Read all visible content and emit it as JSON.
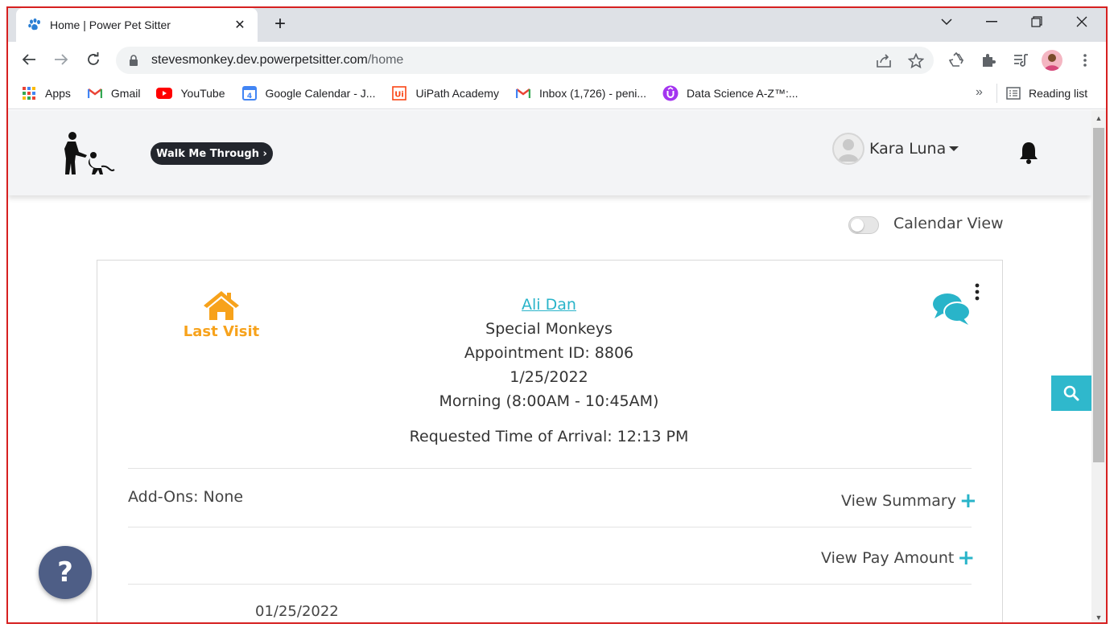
{
  "browser": {
    "tab_title": "Home | Power Pet Sitter",
    "tab_close": "✕",
    "new_tab": "+",
    "url_host": "stevesmonkey.dev.powerpetsitter.com",
    "url_path": "/home",
    "bookmarks": [
      {
        "label": "Apps",
        "icon": "apps-grid-icon"
      },
      {
        "label": "Gmail",
        "icon": "gmail-icon"
      },
      {
        "label": "YouTube",
        "icon": "youtube-icon"
      },
      {
        "label": "Google Calendar - J...",
        "icon": "google-calendar-icon"
      },
      {
        "label": "UiPath Academy",
        "icon": "uipath-icon"
      },
      {
        "label": "Inbox (1,726) - peni...",
        "icon": "gmail-icon"
      },
      {
        "label": "Data Science A-Z™:...",
        "icon": "udemy-icon"
      }
    ],
    "bookmarks_more": "»",
    "reading_list": "Reading list"
  },
  "header": {
    "walk_button": "Walk Me Through ›",
    "user_name": "Kara Luna"
  },
  "view_toggle": {
    "label": "Calendar View",
    "on": false
  },
  "appointment": {
    "status_label": "Last Visit",
    "client_name": "Ali Dan",
    "pet_name": "Special Monkeys",
    "appointment_id": "Appointment ID: 8806",
    "date": "1/25/2022",
    "time_window": "Morning (8:00AM - 10:45AM)",
    "requested_arrival": "Requested Time of Arrival: 12:13 PM",
    "addons": "Add-Ons: None",
    "view_summary": "View Summary",
    "view_pay_amount": "View Pay Amount",
    "plus": "+",
    "footer_date": "01/25/2022"
  },
  "help_label": "?",
  "colors": {
    "accent_teal": "#29b4c9",
    "last_visit_orange": "#f7a21b",
    "help_fab": "#4e5e86",
    "frame_red": "#d62020"
  }
}
